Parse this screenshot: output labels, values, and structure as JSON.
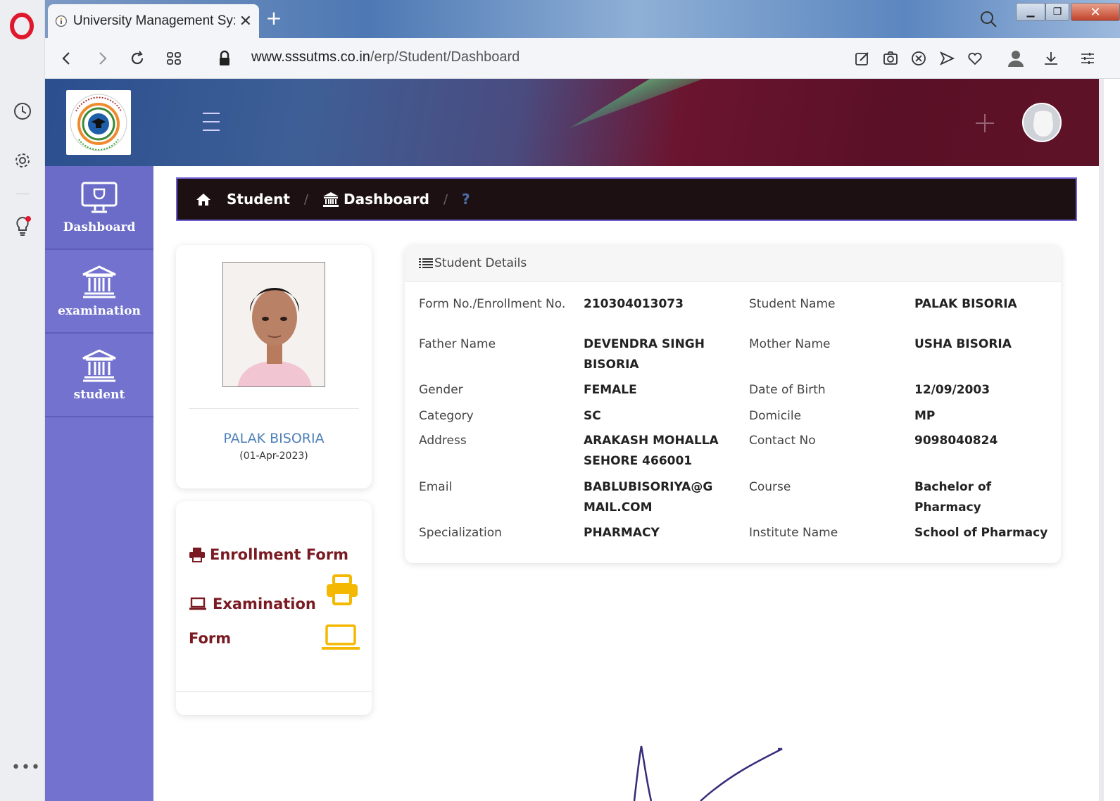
{
  "browser": {
    "tab_title": "University Management Sy:",
    "url_host": "www.sssutms.co.in",
    "url_path": "/erp/Student/Dashboard"
  },
  "sidebar": {
    "items": [
      {
        "label": "Dashboard"
      },
      {
        "label": "examination"
      },
      {
        "label": "student"
      }
    ]
  },
  "breadcrumb": {
    "items": [
      "Student",
      "Dashboard"
    ],
    "separator": "/",
    "help": "?"
  },
  "profile": {
    "name": "PALAK BISORIA",
    "date": "(01-Apr-2023)"
  },
  "forms": {
    "enrollment_label": "Enrollment Form",
    "examination_label_line1": "Examination",
    "examination_label_line2": "Form"
  },
  "details": {
    "title": "Student Details",
    "fields": [
      {
        "label": "Form No./Enrollment No.",
        "value": "210304013073"
      },
      {
        "label": "Student Name",
        "value": "PALAK BISORIA"
      },
      {
        "label": "Father Name",
        "value": "DEVENDRA SINGH BISORIA"
      },
      {
        "label": "Mother Name",
        "value": "USHA BISORIA"
      },
      {
        "label": "Gender",
        "value": "FEMALE"
      },
      {
        "label": "Date of Birth",
        "value": "12/09/2003"
      },
      {
        "label": "Category",
        "value": "SC"
      },
      {
        "label": "Domicile",
        "value": "MP"
      },
      {
        "label": "Address",
        "value": "ARAKASH MOHALLA SEHORE 466001"
      },
      {
        "label": "Contact No",
        "value": "9098040824"
      },
      {
        "label": "Email",
        "value": "BABLUBISORIYA@GMAIL.COM"
      },
      {
        "label": "Course",
        "value": "Bachelor of Pharmacy"
      },
      {
        "label": "Specialization",
        "value": "PHARMACY"
      },
      {
        "label": "Institute Name",
        "value": "School of Pharmacy"
      }
    ]
  },
  "colors": {
    "sidebar": "#7373cf",
    "breadcrumb_bg": "#1d1013",
    "link_red": "#7a1a22",
    "print_yellow": "#f5b800",
    "name_blue": "#4f80b8"
  }
}
